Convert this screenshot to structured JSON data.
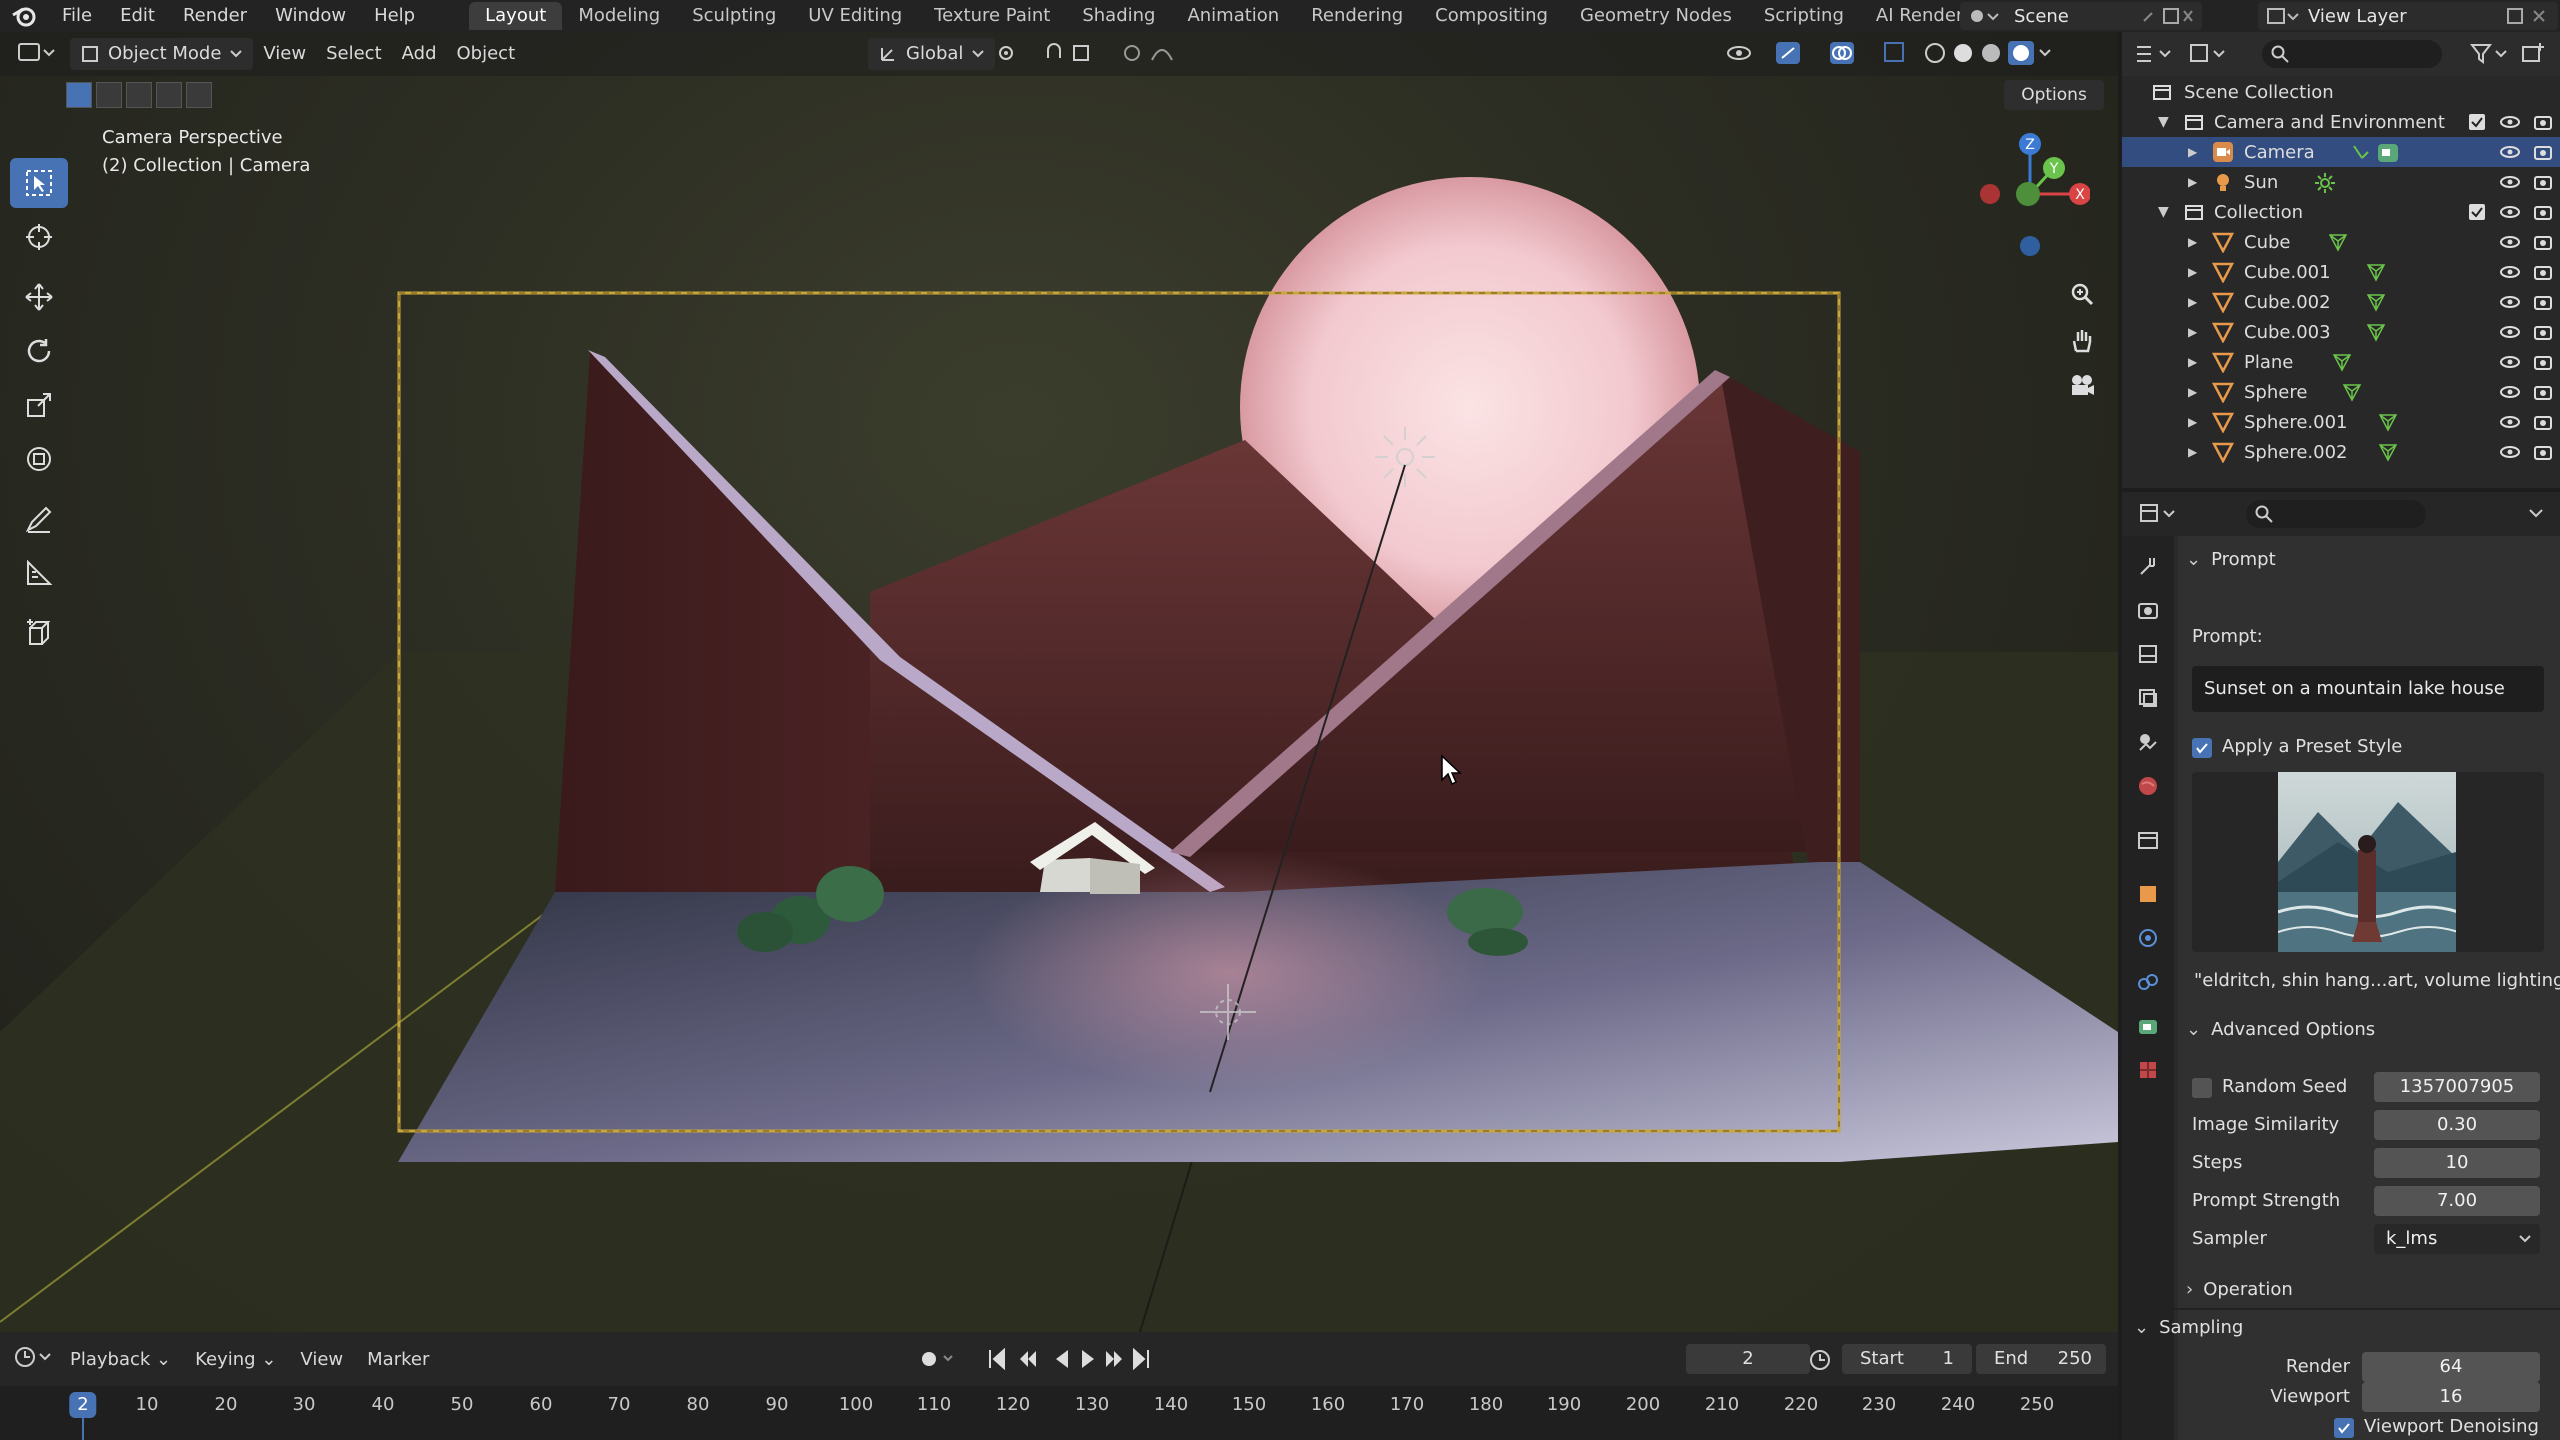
{
  "topbar": {
    "menus": [
      "File",
      "Edit",
      "Render",
      "Window",
      "Help"
    ],
    "workspaces": [
      "Layout",
      "Modeling",
      "Sculpting",
      "UV Editing",
      "Texture Paint",
      "Shading",
      "Animation",
      "Rendering",
      "Compositing",
      "Geometry Nodes",
      "Scripting",
      "AI Render"
    ],
    "active_workspace": "Layout",
    "scene_name": "Scene",
    "view_layer": "View Layer"
  },
  "viewport": {
    "mode": "Object Mode",
    "menus": [
      "View",
      "Select",
      "Add",
      "Object"
    ],
    "transform_orientation": "Global",
    "options_label": "Options",
    "camera_title": "Camera Perspective",
    "camera_subtitle": "(2) Collection | Camera"
  },
  "timeline": {
    "menus": [
      "Playback",
      "Keying",
      "View",
      "Marker"
    ],
    "current_frame": "2",
    "start_label": "Start",
    "start_value": "1",
    "end_label": "End",
    "end_value": "250",
    "ticks": [
      "10",
      "20",
      "30",
      "40",
      "50",
      "60",
      "70",
      "80",
      "90",
      "100",
      "110",
      "120",
      "130",
      "140",
      "150",
      "160",
      "170",
      "180",
      "190",
      "200",
      "210",
      "220",
      "230",
      "240",
      "250"
    ],
    "cursor_frame": "2"
  },
  "outliner": {
    "rows": [
      {
        "label": "Scene Collection",
        "kind": "scene-collection"
      },
      {
        "label": "Camera and Environment",
        "kind": "collection"
      },
      {
        "label": "Camera",
        "kind": "camera",
        "selected": true
      },
      {
        "label": "Sun",
        "kind": "light"
      },
      {
        "label": "Collection",
        "kind": "collection"
      },
      {
        "label": "Cube",
        "kind": "mesh"
      },
      {
        "label": "Cube.001",
        "kind": "mesh"
      },
      {
        "label": "Cube.002",
        "kind": "mesh"
      },
      {
        "label": "Cube.003",
        "kind": "mesh"
      },
      {
        "label": "Plane",
        "kind": "mesh"
      },
      {
        "label": "Sphere",
        "kind": "mesh"
      },
      {
        "label": "Sphere.001",
        "kind": "mesh"
      },
      {
        "label": "Sphere.002",
        "kind": "mesh"
      }
    ]
  },
  "properties": {
    "prompt_panel": "Prompt",
    "prompt_label": "Prompt:",
    "prompt_value": "Sunset on a mountain lake house",
    "preset_label": "Apply a Preset Style",
    "preset_checked": true,
    "preset_caption": "\"eldritch, shin hang...art, volume lighting\"",
    "advanced_panel": "Advanced Options",
    "random_seed_label": "Random Seed",
    "random_seed_value": "1357007905",
    "random_seed_checked": false,
    "similarity_label": "Image Similarity",
    "similarity_value": "0.30",
    "steps_label": "Steps",
    "steps_value": "10",
    "strength_label": "Prompt Strength",
    "strength_value": "7.00",
    "sampler_label": "Sampler",
    "sampler_value": "k_lms",
    "operation_panel": "Operation",
    "sampling_panel": "Sampling",
    "render_label": "Render",
    "render_value": "64",
    "viewport_label": "Viewport",
    "viewport_value": "16",
    "denoise_label": "Viewport Denoising",
    "denoise_checked": true
  },
  "colors": {
    "accent": "#4772b3",
    "selection": "#334d80",
    "camera_frame": "#c9a63a",
    "sky_sun": "#f2c9cf",
    "mountain": "#4a2426"
  }
}
